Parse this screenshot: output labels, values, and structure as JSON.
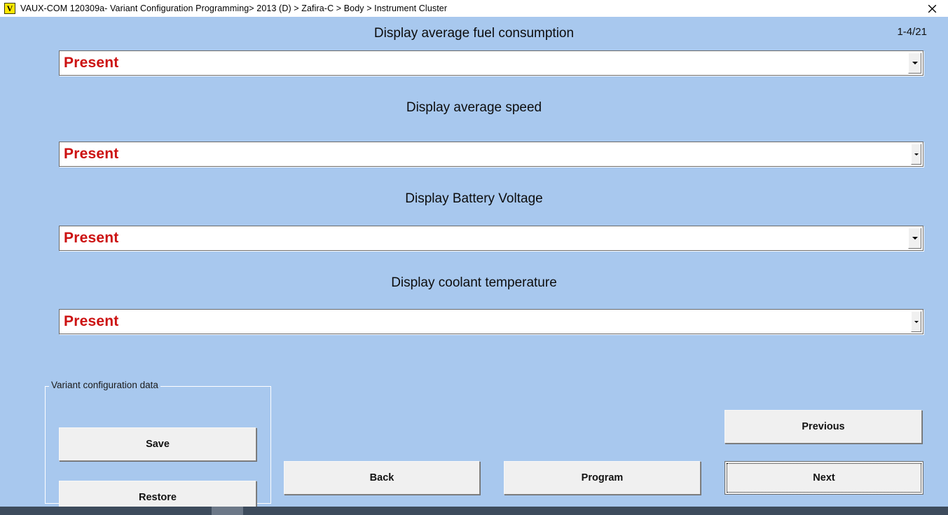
{
  "window": {
    "icon_name": "vaux-com-app-icon",
    "icon_glyph": "V",
    "title": "VAUX-COM 120309a- Variant Configuration Programming> 2013 (D) > Zafira-C > Body > Instrument Cluster",
    "close_label": "✕"
  },
  "page_counter": "1-4/21",
  "colors": {
    "background": "#a8c8ee",
    "value_text": "#cc1111",
    "titlebar": "#ffffff",
    "button_face": "#f0f0f0",
    "taskbar": "#3d4b5c"
  },
  "fields": [
    {
      "label": "Display average fuel consumption",
      "value": "Present"
    },
    {
      "label": "Display average speed",
      "value": "Present"
    },
    {
      "label": "Display Battery Voltage",
      "value": "Present"
    },
    {
      "label": "Display coolant temperature",
      "value": "Present"
    }
  ],
  "groupbox": {
    "title": "Variant configuration data",
    "save_label": "Save",
    "restore_label": "Restore"
  },
  "actions": {
    "back_label": "Back",
    "program_label": "Program",
    "previous_label": "Previous",
    "next_label": "Next"
  },
  "taskbar": {
    "clock": ""
  }
}
